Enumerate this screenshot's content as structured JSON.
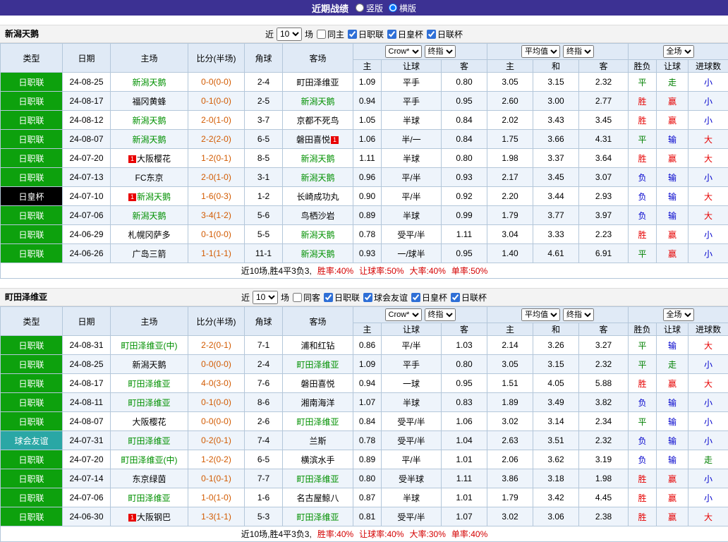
{
  "topbar": {
    "title": "近期战绩",
    "radios": [
      {
        "key": "vertical",
        "label": "竖版",
        "checked": false
      },
      {
        "key": "horizontal",
        "label": "横版",
        "checked": true
      }
    ]
  },
  "ui_colors": {
    "topbar_bg": "#3c3193",
    "section_bar_bg": "#f3f3f3",
    "header_bg": "#e0eaf6",
    "row_alt_bg": "#eef4fb",
    "border": "#b4c7da",
    "team_green": "#009000",
    "score_text": "#d25a00",
    "stat_red": "#d40000",
    "badge_bg": "#e80000"
  },
  "league_colors": {
    "日职联": "#0da10d",
    "日联杯": "#0da10d",
    "日皇杯": "#000000",
    "球会友谊": "#2aa7a5"
  },
  "result_colors": {
    "胜": "#e60000",
    "平": "#008000",
    "负": "#0000cc",
    "赢": "#e60000",
    "走": "#008000",
    "输": "#0000cc",
    "大": "#e60000",
    "小": "#0000cc"
  },
  "table_columns": {
    "type": "类型",
    "date": "日期",
    "home": "主场",
    "score": "比分(半场)",
    "corner": "角球",
    "away": "客场",
    "odds_source": "Crow*",
    "odds_stage": "终指",
    "avg_source": "平均值",
    "avg_stage": "终指",
    "full": "全场",
    "sub": [
      "主",
      "让球",
      "客",
      "主",
      "和",
      "客",
      "胜负",
      "让球",
      "进球数"
    ]
  },
  "sections": [
    {
      "team": "新潟天鹅",
      "filter": {
        "near": "近",
        "count": "10",
        "games": "场",
        "same": {
          "label": "同主",
          "checked": false
        },
        "leagues": [
          {
            "label": "日职联",
            "checked": true
          },
          {
            "label": "日皇杯",
            "checked": true
          },
          {
            "label": "日联杯",
            "checked": true
          }
        ]
      },
      "rows": [
        {
          "type": "日职联",
          "date": "24-08-25",
          "home": {
            "name": "新潟天鹅",
            "green": true
          },
          "score": "0-0(0-0)",
          "corner": "2-4",
          "away": {
            "name": "町田泽维亚",
            "green": false
          },
          "odds": [
            "1.09",
            "平手",
            "0.80"
          ],
          "avg": [
            "3.05",
            "3.15",
            "2.32"
          ],
          "results": [
            "平",
            "走",
            "小"
          ]
        },
        {
          "type": "日职联",
          "date": "24-08-17",
          "home": {
            "name": "福冈黄蜂",
            "green": false
          },
          "score": "0-1(0-0)",
          "corner": "2-5",
          "away": {
            "name": "新潟天鹅",
            "green": true
          },
          "odds": [
            "0.94",
            "平手",
            "0.95"
          ],
          "avg": [
            "2.60",
            "3.00",
            "2.77"
          ],
          "results": [
            "胜",
            "赢",
            "小"
          ]
        },
        {
          "type": "日职联",
          "date": "24-08-12",
          "home": {
            "name": "新潟天鹅",
            "green": true
          },
          "score": "2-0(1-0)",
          "corner": "3-7",
          "away": {
            "name": "京都不死鸟",
            "green": false
          },
          "odds": [
            "1.05",
            "半球",
            "0.84"
          ],
          "avg": [
            "2.02",
            "3.43",
            "3.45"
          ],
          "results": [
            "胜",
            "赢",
            "小"
          ]
        },
        {
          "type": "日职联",
          "date": "24-08-07",
          "home": {
            "name": "新潟天鹅",
            "green": true
          },
          "score": "2-2(2-0)",
          "corner": "6-5",
          "away": {
            "name": "磐田喜悦",
            "green": false,
            "badge_post": "1"
          },
          "odds": [
            "1.06",
            "半/一",
            "0.84"
          ],
          "avg": [
            "1.75",
            "3.66",
            "4.31"
          ],
          "results": [
            "平",
            "输",
            "大"
          ]
        },
        {
          "type": "日职联",
          "date": "24-07-20",
          "home": {
            "name": "大阪樱花",
            "green": false,
            "badge_pre": "1"
          },
          "score": "1-2(0-1)",
          "corner": "8-5",
          "away": {
            "name": "新潟天鹅",
            "green": true
          },
          "odds": [
            "1.11",
            "半球",
            "0.80"
          ],
          "avg": [
            "1.98",
            "3.37",
            "3.64"
          ],
          "results": [
            "胜",
            "赢",
            "大"
          ]
        },
        {
          "type": "日职联",
          "date": "24-07-13",
          "home": {
            "name": "FC东京",
            "green": false
          },
          "score": "2-0(1-0)",
          "corner": "3-1",
          "away": {
            "name": "新潟天鹅",
            "green": true
          },
          "odds": [
            "0.96",
            "平/半",
            "0.93"
          ],
          "avg": [
            "2.17",
            "3.45",
            "3.07"
          ],
          "results": [
            "负",
            "输",
            "小"
          ]
        },
        {
          "type": "日皇杯",
          "date": "24-07-10",
          "home": {
            "name": "新潟天鹅",
            "green": true,
            "badge_pre": "1"
          },
          "score": "1-6(0-3)",
          "corner": "1-2",
          "away": {
            "name": "长崎成功丸",
            "green": false
          },
          "odds": [
            "0.90",
            "平/半",
            "0.92"
          ],
          "avg": [
            "2.20",
            "3.44",
            "2.93"
          ],
          "results": [
            "负",
            "输",
            "大"
          ]
        },
        {
          "type": "日职联",
          "date": "24-07-06",
          "home": {
            "name": "新潟天鹅",
            "green": true
          },
          "score": "3-4(1-2)",
          "corner": "5-6",
          "away": {
            "name": "鸟栖沙岩",
            "green": false
          },
          "odds": [
            "0.89",
            "半球",
            "0.99"
          ],
          "avg": [
            "1.79",
            "3.77",
            "3.97"
          ],
          "results": [
            "负",
            "输",
            "大"
          ]
        },
        {
          "type": "日职联",
          "date": "24-06-29",
          "home": {
            "name": "札幌冈萨多",
            "green": false
          },
          "score": "0-1(0-0)",
          "corner": "5-5",
          "away": {
            "name": "新潟天鹅",
            "green": true
          },
          "odds": [
            "0.78",
            "受平/半",
            "1.11"
          ],
          "avg": [
            "3.04",
            "3.33",
            "2.23"
          ],
          "results": [
            "胜",
            "赢",
            "小"
          ]
        },
        {
          "type": "日职联",
          "date": "24-06-26",
          "home": {
            "name": "广岛三箭",
            "green": false
          },
          "score": "1-1(1-1)",
          "corner": "11-1",
          "away": {
            "name": "新潟天鹅",
            "green": true
          },
          "odds": [
            "0.93",
            "一/球半",
            "0.95"
          ],
          "avg": [
            "1.40",
            "4.61",
            "6.91"
          ],
          "results": [
            "平",
            "赢",
            "小"
          ]
        }
      ],
      "summary": {
        "prefix": "近10场,胜4平3负3,",
        "stats": [
          "胜率:40%",
          "让球率:50%",
          "大率:40%",
          "单率:50%"
        ]
      }
    },
    {
      "team": "町田泽维亚",
      "filter": {
        "near": "近",
        "count": "10",
        "games": "场",
        "same": {
          "label": "同客",
          "checked": false
        },
        "leagues": [
          {
            "label": "日职联",
            "checked": true
          },
          {
            "label": "球会友谊",
            "checked": true
          },
          {
            "label": "日皇杯",
            "checked": true
          },
          {
            "label": "日联杯",
            "checked": true
          }
        ]
      },
      "rows": [
        {
          "type": "日职联",
          "date": "24-08-31",
          "home": {
            "name": "町田泽维亚(中)",
            "green": true
          },
          "score": "2-2(0-1)",
          "corner": "7-1",
          "away": {
            "name": "浦和红钻",
            "green": false
          },
          "odds": [
            "0.86",
            "平/半",
            "1.03"
          ],
          "avg": [
            "2.14",
            "3.26",
            "3.27"
          ],
          "results": [
            "平",
            "输",
            "大"
          ]
        },
        {
          "type": "日职联",
          "date": "24-08-25",
          "home": {
            "name": "新潟天鹅",
            "green": false
          },
          "score": "0-0(0-0)",
          "corner": "2-4",
          "away": {
            "name": "町田泽维亚",
            "green": true
          },
          "odds": [
            "1.09",
            "平手",
            "0.80"
          ],
          "avg": [
            "3.05",
            "3.15",
            "2.32"
          ],
          "results": [
            "平",
            "走",
            "小"
          ]
        },
        {
          "type": "日职联",
          "date": "24-08-17",
          "home": {
            "name": "町田泽维亚",
            "green": true
          },
          "score": "4-0(3-0)",
          "corner": "7-6",
          "away": {
            "name": "磐田喜悦",
            "green": false
          },
          "odds": [
            "0.94",
            "一球",
            "0.95"
          ],
          "avg": [
            "1.51",
            "4.05",
            "5.88"
          ],
          "results": [
            "胜",
            "赢",
            "大"
          ]
        },
        {
          "type": "日职联",
          "date": "24-08-11",
          "home": {
            "name": "町田泽维亚",
            "green": true
          },
          "score": "0-1(0-0)",
          "corner": "8-6",
          "away": {
            "name": "湘南海洋",
            "green": false
          },
          "odds": [
            "1.07",
            "半球",
            "0.83"
          ],
          "avg": [
            "1.89",
            "3.49",
            "3.82"
          ],
          "results": [
            "负",
            "输",
            "小"
          ]
        },
        {
          "type": "日职联",
          "date": "24-08-07",
          "home": {
            "name": "大阪樱花",
            "green": false
          },
          "score": "0-0(0-0)",
          "corner": "2-6",
          "away": {
            "name": "町田泽维亚",
            "green": true
          },
          "odds": [
            "0.84",
            "受平/半",
            "1.06"
          ],
          "avg": [
            "3.02",
            "3.14",
            "2.34"
          ],
          "results": [
            "平",
            "输",
            "小"
          ]
        },
        {
          "type": "球会友谊",
          "date": "24-07-31",
          "home": {
            "name": "町田泽维亚",
            "green": true
          },
          "score": "0-2(0-1)",
          "corner": "7-4",
          "away": {
            "name": "兰斯",
            "green": false
          },
          "odds": [
            "0.78",
            "受平/半",
            "1.04"
          ],
          "avg": [
            "2.63",
            "3.51",
            "2.32"
          ],
          "results": [
            "负",
            "输",
            "小"
          ]
        },
        {
          "type": "日职联",
          "date": "24-07-20",
          "home": {
            "name": "町田泽维亚(中)",
            "green": true
          },
          "score": "1-2(0-2)",
          "corner": "6-5",
          "away": {
            "name": "横滨水手",
            "green": false
          },
          "odds": [
            "0.89",
            "平/半",
            "1.01"
          ],
          "avg": [
            "2.06",
            "3.62",
            "3.19"
          ],
          "results": [
            "负",
            "输",
            "走"
          ]
        },
        {
          "type": "日职联",
          "date": "24-07-14",
          "home": {
            "name": "东京绿茵",
            "green": false
          },
          "score": "0-1(0-1)",
          "corner": "7-7",
          "away": {
            "name": "町田泽维亚",
            "green": true
          },
          "odds": [
            "0.80",
            "受半球",
            "1.11"
          ],
          "avg": [
            "3.86",
            "3.18",
            "1.98"
          ],
          "results": [
            "胜",
            "赢",
            "小"
          ]
        },
        {
          "type": "日职联",
          "date": "24-07-06",
          "home": {
            "name": "町田泽维亚",
            "green": true
          },
          "score": "1-0(1-0)",
          "corner": "1-6",
          "away": {
            "name": "名古屋鲸八",
            "green": false
          },
          "odds": [
            "0.87",
            "半球",
            "1.01"
          ],
          "avg": [
            "1.79",
            "3.42",
            "4.45"
          ],
          "results": [
            "胜",
            "赢",
            "小"
          ]
        },
        {
          "type": "日职联",
          "date": "24-06-30",
          "home": {
            "name": "大阪钢巴",
            "green": false,
            "badge_pre": "1"
          },
          "score": "1-3(1-1)",
          "corner": "5-3",
          "away": {
            "name": "町田泽维亚",
            "green": true
          },
          "odds": [
            "0.81",
            "受平/半",
            "1.07"
          ],
          "avg": [
            "3.02",
            "3.06",
            "2.38"
          ],
          "results": [
            "胜",
            "赢",
            "大"
          ]
        }
      ],
      "summary": {
        "prefix": "近10场,胜4平3负3,",
        "stats": [
          "胜率:40%",
          "让球率:40%",
          "大率:30%",
          "单率:40%"
        ]
      }
    }
  ]
}
